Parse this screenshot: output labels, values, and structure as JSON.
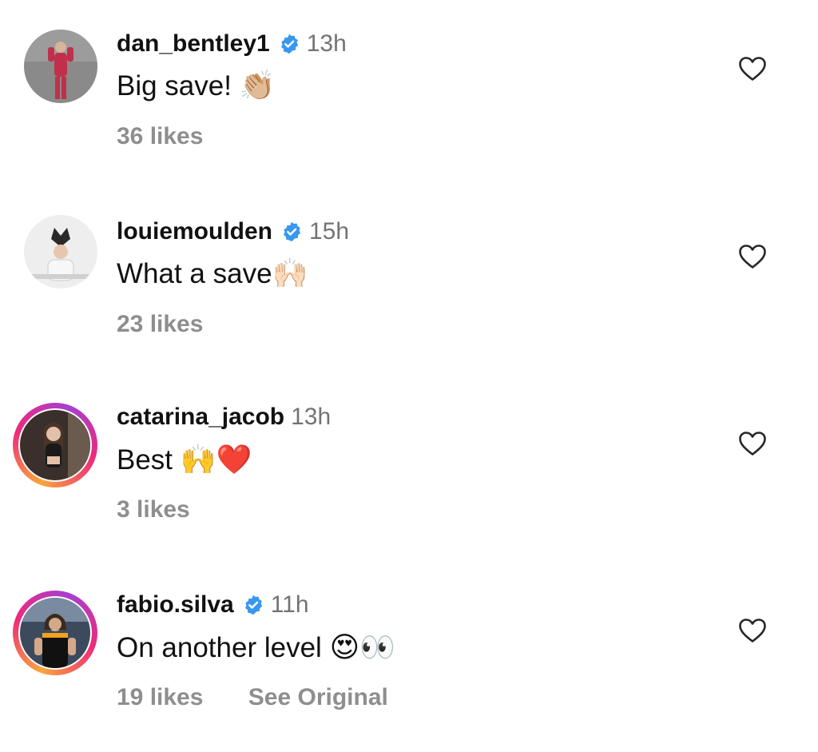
{
  "comments": [
    {
      "username": "dan_bentley1",
      "verified": true,
      "time": "13h",
      "text": "Big save!",
      "emoji": "👏🏼",
      "likes": "36 likes",
      "see_original": ""
    },
    {
      "username": "louiemoulden",
      "verified": true,
      "time": "15h",
      "text": "What a save",
      "emoji": "🙌🏻",
      "likes": "23 likes",
      "see_original": ""
    },
    {
      "username": "catarina_jacob",
      "verified": false,
      "time": "13h",
      "text": "Best",
      "emoji": "🙌❤️",
      "likes": "3 likes",
      "see_original": ""
    },
    {
      "username": "fabio.silva",
      "verified": true,
      "time": "11h",
      "text": "On another level",
      "emoji": "😍👀",
      "likes": "19 likes",
      "see_original": "See Original"
    }
  ],
  "colors": {
    "verified_blue": "#3897f0",
    "secondary_text": "#8e8e8e",
    "time_text": "#737373"
  },
  "icons": {
    "like": "heart-outline-icon",
    "verified": "verified-badge-icon"
  }
}
